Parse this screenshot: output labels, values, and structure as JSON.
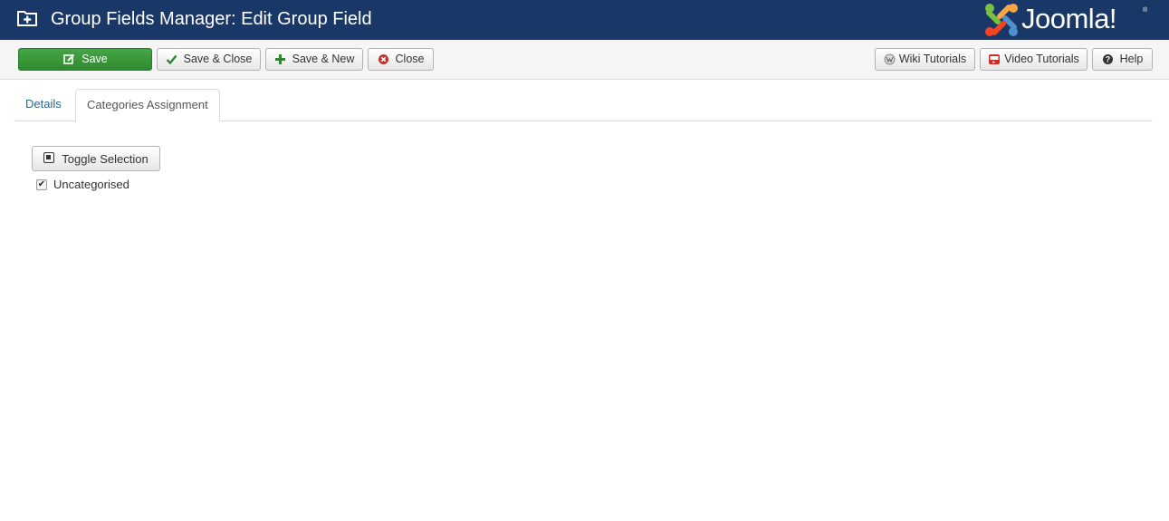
{
  "header": {
    "title": "Group Fields Manager: Edit Group Field",
    "icon": "folder-plus-icon",
    "brand": "Joomla!",
    "brand_reg": "®",
    "background": "#1a3867"
  },
  "toolbar": {
    "save": {
      "label": "Save",
      "icon": "edit-icon",
      "color": "#46a546"
    },
    "save_close": {
      "label": "Save & Close",
      "icon": "checkmark-icon",
      "icon_color": "#378137"
    },
    "save_new": {
      "label": "Save & New",
      "icon": "plus-icon",
      "icon_color": "#378137"
    },
    "close": {
      "label": "Close",
      "icon": "cancel-circle-icon",
      "icon_color": "#bd362f"
    },
    "wiki": {
      "label": "Wiki Tutorials",
      "icon": "wikipedia-icon"
    },
    "video": {
      "label": "Video Tutorials",
      "icon": "youtube-icon"
    },
    "help": {
      "label": "Help",
      "icon": "question-circle-icon"
    }
  },
  "tabs": [
    {
      "label": "Details",
      "active": false
    },
    {
      "label": "Categories Assignment",
      "active": true
    }
  ],
  "categories": {
    "toggle_label": "Toggle Selection",
    "items": [
      {
        "label": "Uncategorised",
        "checked": true
      }
    ]
  }
}
